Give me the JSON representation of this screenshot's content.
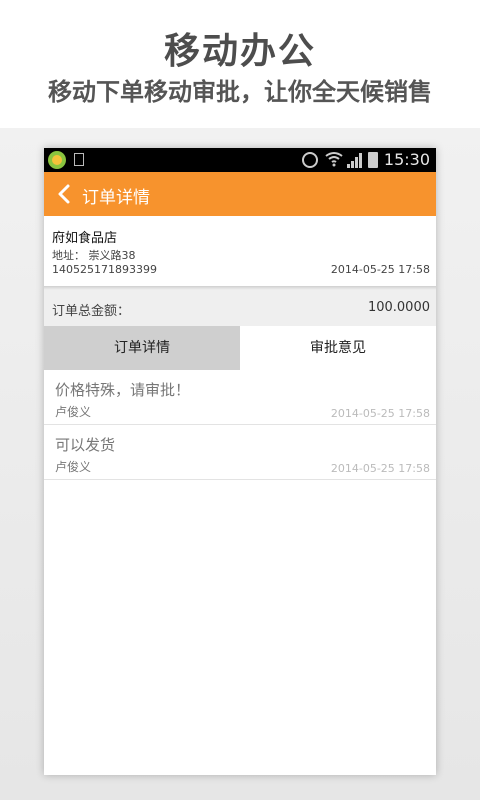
{
  "promo": {
    "title": "移动办公",
    "subtitle": "移动下单移动审批，让你全天候销售"
  },
  "statusbar": {
    "time": "15:30",
    "icons": [
      "app-icon",
      "sd-card-icon",
      "alarm-icon",
      "wifi-icon",
      "signal-icon",
      "battery-icon"
    ]
  },
  "appbar": {
    "title": "订单详情",
    "back_icon": "chevron-left-icon",
    "background": "#f7932d"
  },
  "store": {
    "name": "府如食品店",
    "address": "地址：  崇义路38",
    "phone": "140525171893399",
    "datetime": "2014-05-25 17:58"
  },
  "total": {
    "label": "订单总金额：",
    "value": "100.0000"
  },
  "tabs": [
    {
      "label": "订单详情",
      "selected": true
    },
    {
      "label": "审批意见",
      "selected": false
    }
  ],
  "comments": [
    {
      "text": "价格特殊，请审批！",
      "author": "卢俊义",
      "time": "2014-05-25 17:58"
    },
    {
      "text": "可以发货",
      "author": "卢俊义",
      "time": "2014-05-25 17:58"
    }
  ]
}
